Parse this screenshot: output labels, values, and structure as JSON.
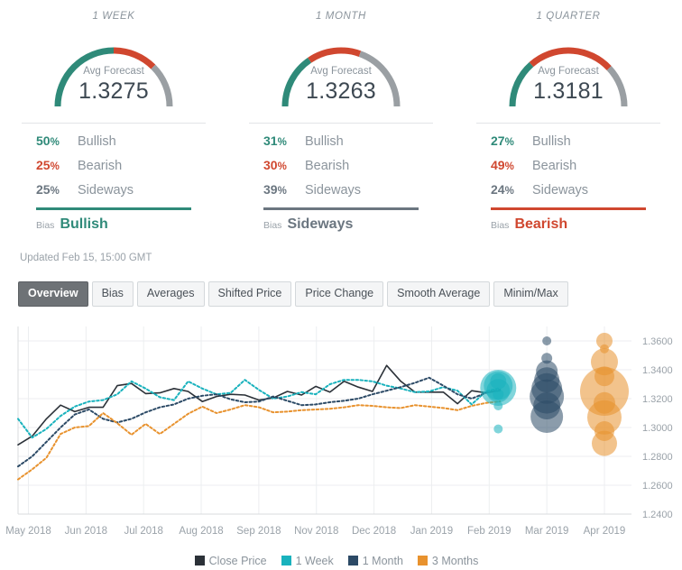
{
  "panels": [
    {
      "title": "1 WEEK",
      "caption": "Avg Forecast",
      "value": "1.3275",
      "stats": [
        {
          "pct": "50",
          "sym": "%",
          "label": "Bullish",
          "color": "#2f8a79"
        },
        {
          "pct": "25",
          "sym": "%",
          "label": "Bearish",
          "color": "#d0472f"
        },
        {
          "pct": "25",
          "sym": "%",
          "label": "Sideways",
          "color": "#6b7680"
        }
      ],
      "bias_word": "Bias",
      "bias_value": "Bullish",
      "bias_color": "#2f8a79",
      "gauge": {
        "bullish": 50,
        "bearish": 25,
        "sideways": 25
      }
    },
    {
      "title": "1 MONTH",
      "caption": "Avg Forecast",
      "value": "1.3263",
      "stats": [
        {
          "pct": "31",
          "sym": "%",
          "label": "Bullish",
          "color": "#2f8a79"
        },
        {
          "pct": "30",
          "sym": "%",
          "label": "Bearish",
          "color": "#d0472f"
        },
        {
          "pct": "39",
          "sym": "%",
          "label": "Sideways",
          "color": "#6b7680"
        }
      ],
      "bias_word": "Bias",
      "bias_value": "Sideways",
      "bias_color": "#6b7680",
      "gauge": {
        "bullish": 31,
        "bearish": 30,
        "sideways": 39
      }
    },
    {
      "title": "1 QUARTER",
      "caption": "Avg Forecast",
      "value": "1.3181",
      "stats": [
        {
          "pct": "27",
          "sym": "%",
          "label": "Bullish",
          "color": "#2f8a79"
        },
        {
          "pct": "49",
          "sym": "%",
          "label": "Bearish",
          "color": "#d0472f"
        },
        {
          "pct": "24",
          "sym": "%",
          "label": "Sideways",
          "color": "#6b7680"
        }
      ],
      "bias_word": "Bias",
      "bias_value": "Bearish",
      "bias_color": "#d0472f",
      "gauge": {
        "bullish": 27,
        "bearish": 49,
        "sideways": 24
      }
    }
  ],
  "updated": "Updated Feb 15, 15:00 GMT",
  "tabs": [
    {
      "label": "Overview",
      "active": true
    },
    {
      "label": "Bias",
      "active": false
    },
    {
      "label": "Averages",
      "active": false
    },
    {
      "label": "Shifted Price",
      "active": false
    },
    {
      "label": "Price Change",
      "active": false
    },
    {
      "label": "Smooth Average",
      "active": false
    },
    {
      "label": "Minim/Max",
      "active": false
    }
  ],
  "colors": {
    "bullish": "#2f8a79",
    "bearish": "#d0472f",
    "sideways": "#9a9fa3",
    "close_price": "#2b3138",
    "week": "#19b2bd",
    "month": "#2c4a66",
    "months3": "#e8922e"
  },
  "chart_data": {
    "type": "line",
    "title": "",
    "xlabel": "",
    "ylabel": "",
    "ylim": [
      1.24,
      1.37
    ],
    "yticks": [
      "1.3600",
      "1.3400",
      "1.3200",
      "1.3000",
      "1.2800",
      "1.2600",
      "1.2400"
    ],
    "ytick_values": [
      1.36,
      1.34,
      1.32,
      1.3,
      1.28,
      1.26,
      1.24
    ],
    "xticks": [
      "May 2018",
      "Jun 2018",
      "Jul 2018",
      "Aug 2018",
      "Sep 2018",
      "Nov 2018",
      "Dec 2018",
      "Jan 2019",
      "Feb 2019",
      "Mar 2019",
      "Apr 2019"
    ],
    "grid": true,
    "legend_position": "bottom",
    "legend": [
      "Close Price",
      "1 Week",
      "1 Month",
      "3 Months"
    ],
    "series": [
      {
        "name": "Close Price",
        "color": "#2b3138",
        "style": "solid",
        "values": [
          1.288,
          1.294,
          1.306,
          1.3155,
          1.311,
          1.314,
          1.314,
          1.329,
          1.3305,
          1.3235,
          1.324,
          1.327,
          1.325,
          1.318,
          1.3215,
          1.323,
          1.3225,
          1.319,
          1.3205,
          1.325,
          1.3225,
          1.3285,
          1.3245,
          1.332,
          1.328,
          1.325,
          1.343,
          1.332,
          1.3245,
          1.3245,
          1.3245,
          1.3165,
          1.3255,
          1.324,
          1.3255
        ]
      },
      {
        "name": "1 Week",
        "color": "#19b2bd",
        "style": "dotted",
        "values": [
          1.306,
          1.293,
          1.299,
          1.308,
          1.3145,
          1.318,
          1.319,
          1.323,
          1.332,
          1.327,
          1.321,
          1.319,
          1.332,
          1.327,
          1.323,
          1.324,
          1.333,
          1.326,
          1.32,
          1.3215,
          1.3245,
          1.323,
          1.33,
          1.333,
          1.333,
          1.332,
          1.329,
          1.327,
          1.3245,
          1.325,
          1.328,
          1.3255,
          1.316,
          1.325,
          1.3275
        ]
      },
      {
        "name": "1 Month",
        "color": "#2c4a66",
        "style": "dotted",
        "values": [
          1.273,
          1.28,
          1.29,
          1.3,
          1.309,
          1.3125,
          1.306,
          1.3035,
          1.306,
          1.3105,
          1.314,
          1.316,
          1.32,
          1.322,
          1.323,
          1.3195,
          1.3175,
          1.318,
          1.3215,
          1.3185,
          1.3155,
          1.316,
          1.3175,
          1.3185,
          1.32,
          1.323,
          1.3255,
          1.328,
          1.331,
          1.3345,
          1.329,
          1.323,
          1.32,
          1.324,
          1.3263
        ]
      },
      {
        "name": "3 Months",
        "color": "#e8922e",
        "style": "dotted",
        "values": [
          1.264,
          1.271,
          1.279,
          1.2955,
          1.3,
          1.301,
          1.31,
          1.303,
          1.295,
          1.3025,
          1.2955,
          1.3025,
          1.3095,
          1.3145,
          1.31,
          1.3125,
          1.3155,
          1.314,
          1.3105,
          1.311,
          1.312,
          1.3125,
          1.313,
          1.314,
          1.3155,
          1.315,
          1.314,
          1.3135,
          1.3155,
          1.3145,
          1.3135,
          1.312,
          1.315,
          1.317,
          1.3181
        ]
      }
    ],
    "bubble_clusters": [
      {
        "name": "1 Week",
        "color": "#19b2bd",
        "x_label": "Feb 2019",
        "points": [
          {
            "y": 1.332,
            "size": 9
          },
          {
            "y": 1.329,
            "size": 16
          },
          {
            "y": 1.3275,
            "size": 20
          },
          {
            "y": 1.3255,
            "size": 13
          },
          {
            "y": 1.323,
            "size": 6
          },
          {
            "y": 1.315,
            "size": 5
          },
          {
            "y": 1.299,
            "size": 5
          }
        ]
      },
      {
        "name": "1 Month",
        "color": "#2c4a66",
        "x_label": "Mar 2019",
        "points": [
          {
            "y": 1.36,
            "size": 5
          },
          {
            "y": 1.348,
            "size": 6
          },
          {
            "y": 1.339,
            "size": 12
          },
          {
            "y": 1.333,
            "size": 14
          },
          {
            "y": 1.327,
            "size": 17
          },
          {
            "y": 1.3215,
            "size": 19
          },
          {
            "y": 1.315,
            "size": 15
          },
          {
            "y": 1.3075,
            "size": 18
          }
        ]
      },
      {
        "name": "3 Months",
        "color": "#e8922e",
        "x_label": "Apr 2019",
        "points": [
          {
            "y": 1.36,
            "size": 9
          },
          {
            "y": 1.3545,
            "size": 5
          },
          {
            "y": 1.3455,
            "size": 15
          },
          {
            "y": 1.3355,
            "size": 11
          },
          {
            "y": 1.325,
            "size": 27
          },
          {
            "y": 1.317,
            "size": 12
          },
          {
            "y": 1.307,
            "size": 19
          },
          {
            "y": 1.2975,
            "size": 11
          },
          {
            "y": 1.289,
            "size": 14
          }
        ]
      }
    ]
  }
}
